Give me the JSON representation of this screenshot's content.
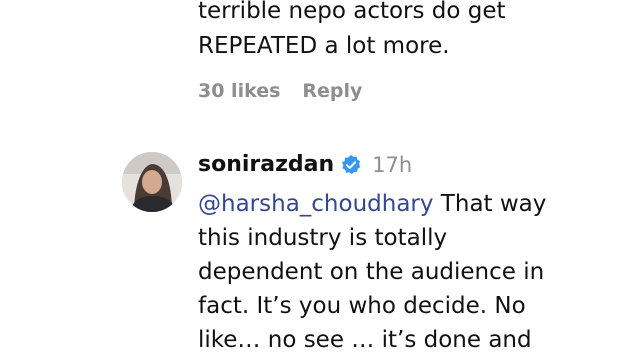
{
  "previous_comment": {
    "lines": [
      "terrible nepo actors do get",
      "REPEATED a lot more."
    ],
    "likes": "30 likes",
    "reply": "Reply"
  },
  "comment": {
    "username": "sonirazdan",
    "verified_icon": "verified-badge-icon",
    "time": "17h",
    "mention": "@harsha_choudhary",
    "first_line_rest": " That way",
    "lines": [
      "this industry is totally",
      "dependent on the audience in",
      "fact. It’s you who decide. No",
      "like… no see … it’s done and"
    ],
    "colors": {
      "mention": "#36468f",
      "verified": "#3797f0",
      "muted": "#8e8e8e"
    }
  }
}
